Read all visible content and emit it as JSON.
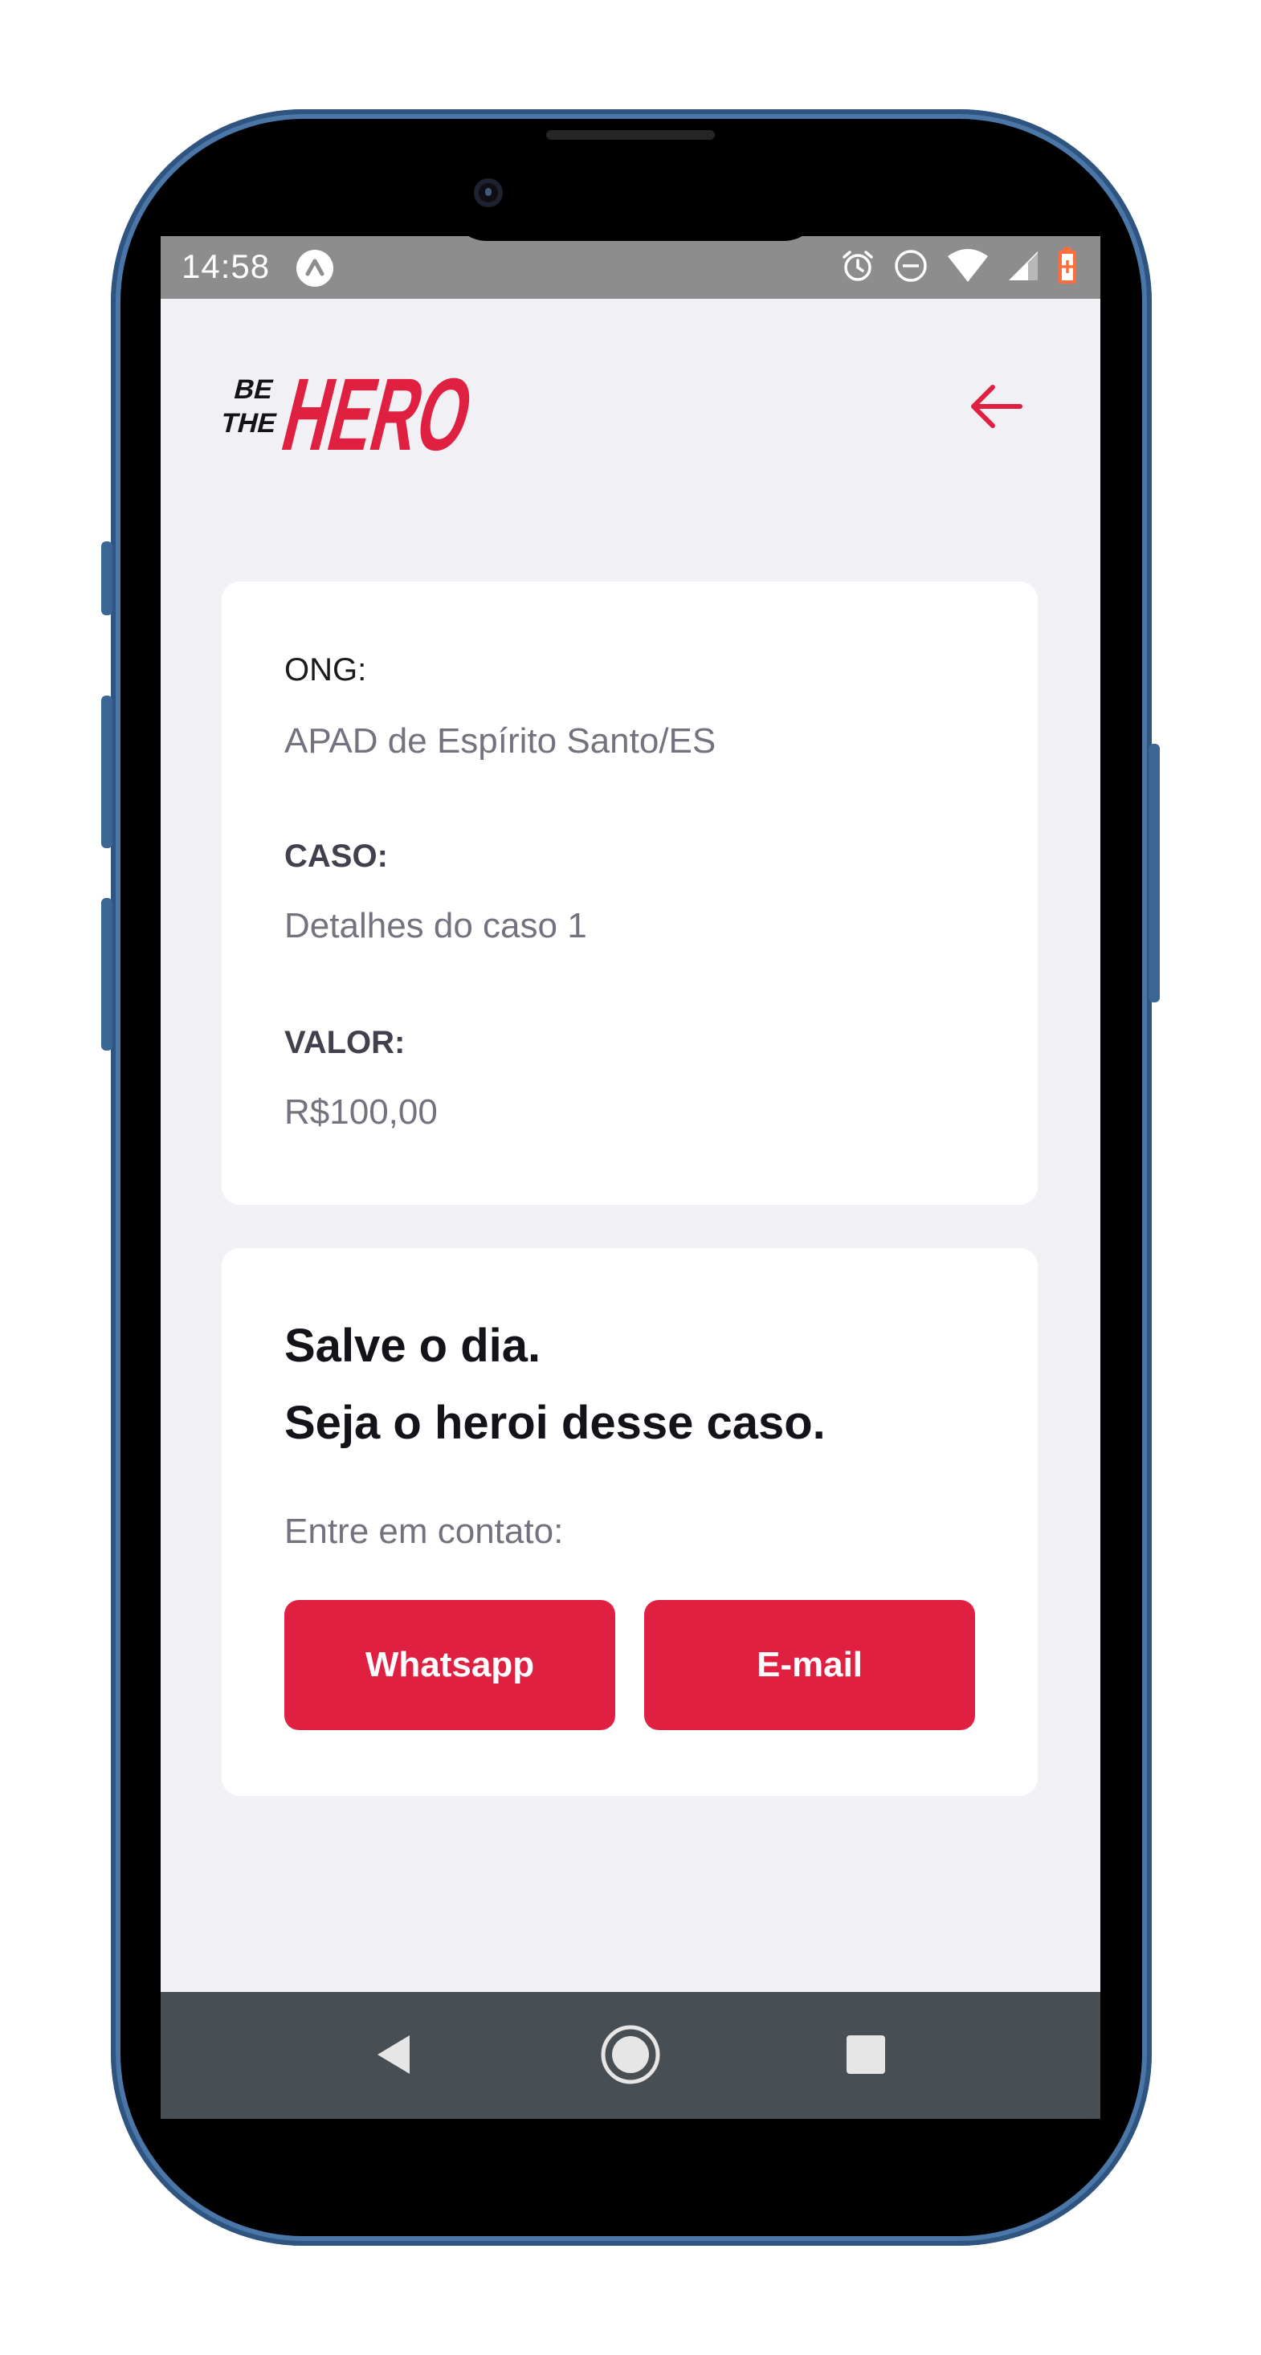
{
  "status_bar": {
    "time": "14:58",
    "icons": [
      "a-launcher-icon",
      "alarm-icon",
      "do-not-disturb-icon",
      "wifi-icon",
      "signal-icon",
      "battery-icon"
    ]
  },
  "header": {
    "logo_text": "BE THE HERO",
    "back_icon": "arrow-left-icon"
  },
  "incident": {
    "ong_label": "ONG:",
    "ong_value": "APAD de Espírito Santo/ES",
    "case_label": "CASO:",
    "case_value": "Detalhes do caso 1",
    "value_label": "VALOR:",
    "value_value": "R$100,00"
  },
  "contact": {
    "title_line1": "Salve o dia.",
    "title_line2": "Seja o heroi desse caso.",
    "description": "Entre em contato:",
    "whatsapp_label": "Whatsapp",
    "email_label": "E-mail"
  },
  "nav_bar": {
    "back_icon": "triangle-back-icon",
    "home_icon": "circle-home-icon",
    "recents_icon": "square-recents-icon"
  },
  "colors": {
    "brand": "#e02041",
    "background": "#f0f0f5",
    "card": "#ffffff",
    "status_bar": "#8d8d8d",
    "nav_bar": "#474e54",
    "device_frame": "#4a76a8"
  }
}
